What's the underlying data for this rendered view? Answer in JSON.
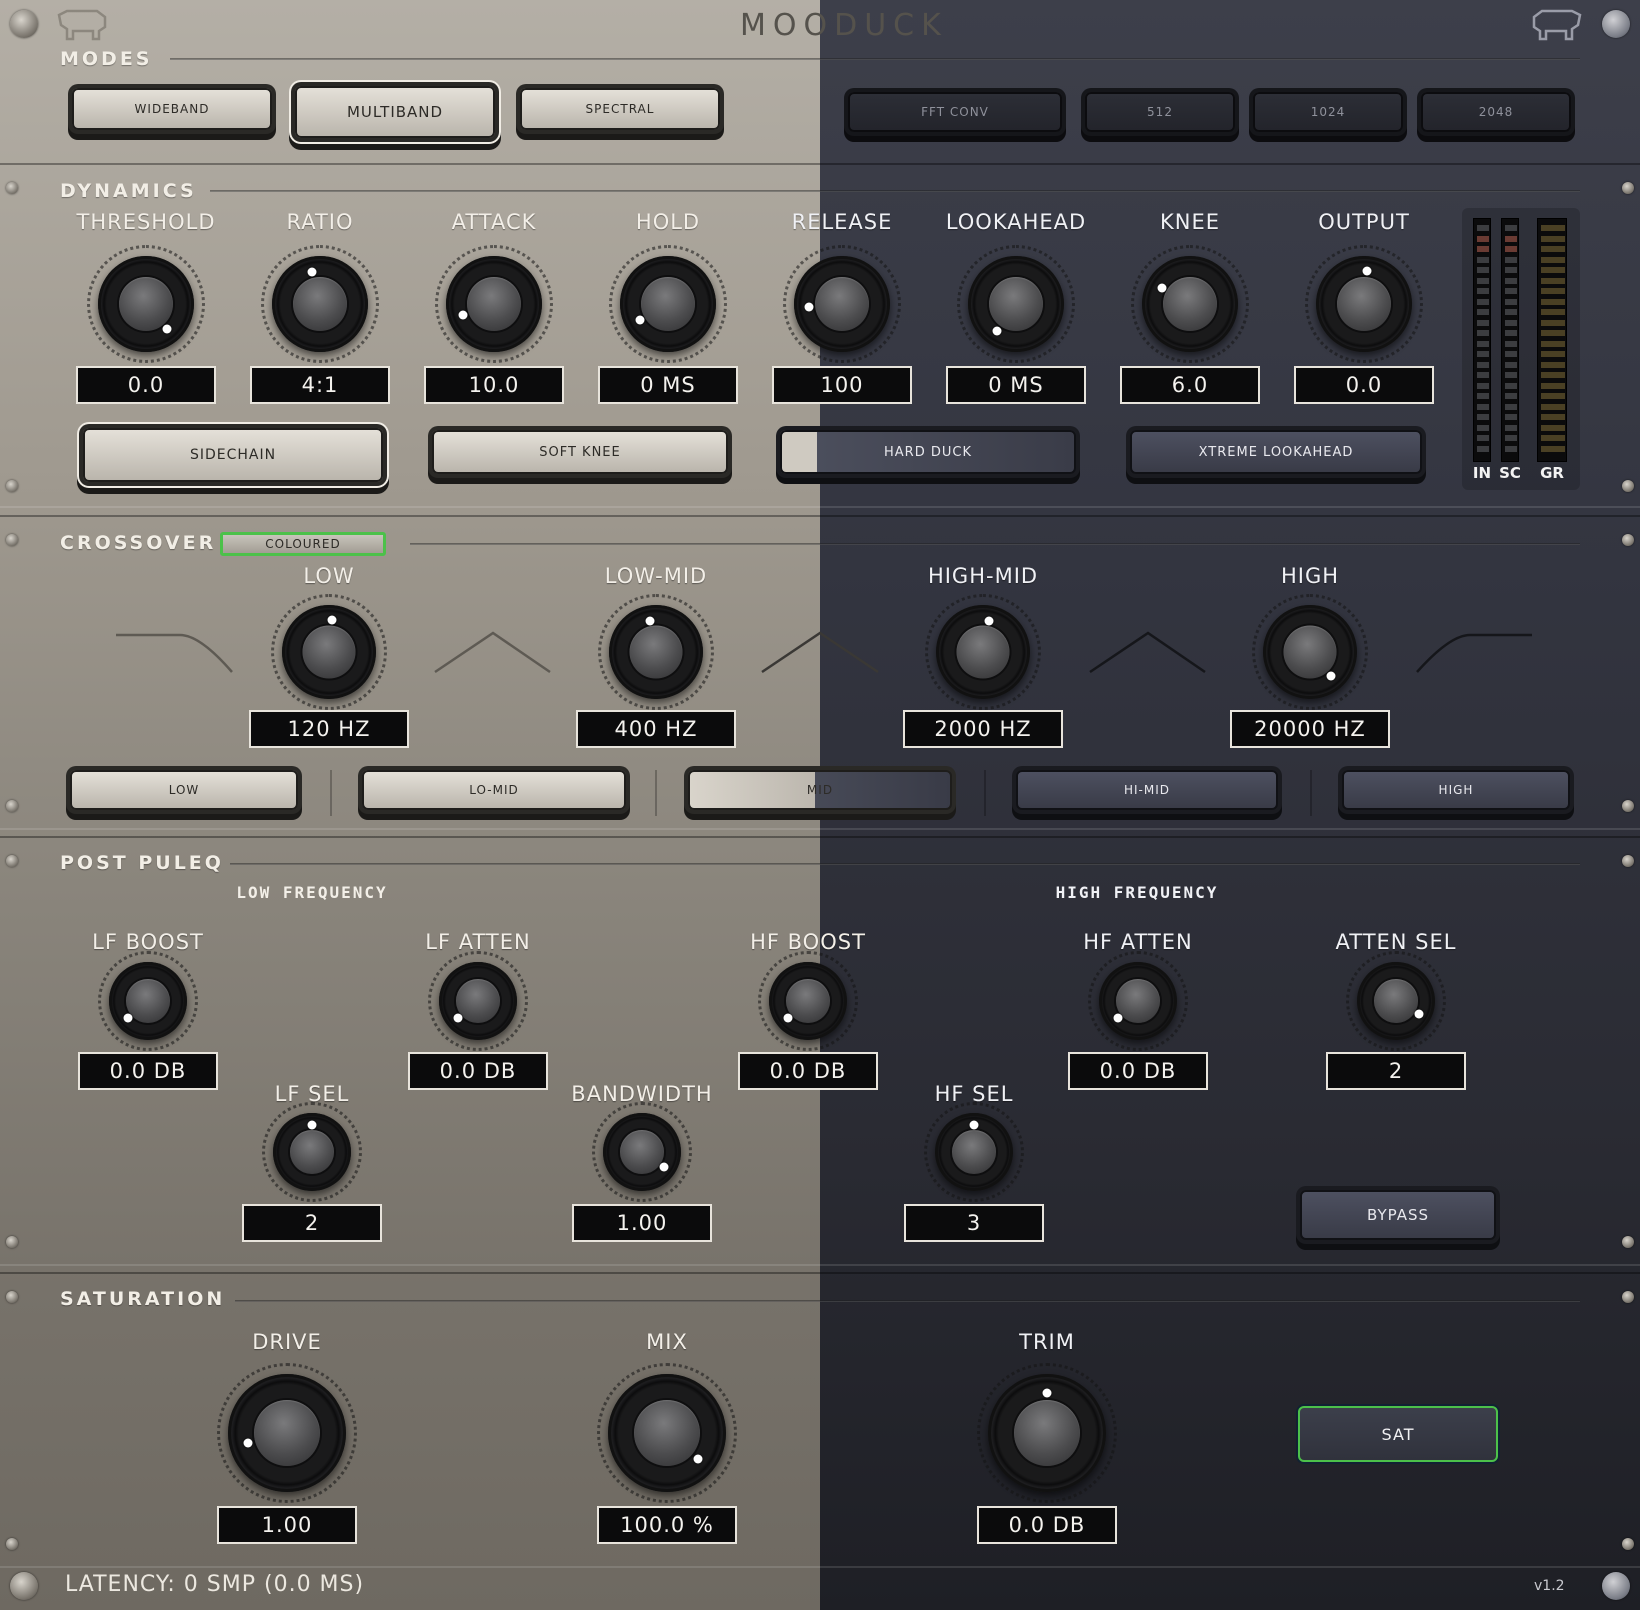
{
  "header": {
    "title": "MOODUCK",
    "version": "v1.2"
  },
  "modes": {
    "title": "MODES",
    "buttons": [
      "WIDEBAND",
      "MULTIBAND",
      "SPECTRAL"
    ],
    "selected": "MULTIBAND",
    "fft_buttons": [
      "FFT CONV",
      "512",
      "1024",
      "2048"
    ]
  },
  "dynamics": {
    "title": "DYNAMICS",
    "knobs": [
      {
        "label": "THRESHOLD",
        "value": "0.0"
      },
      {
        "label": "RATIO",
        "value": "4:1"
      },
      {
        "label": "ATTACK",
        "value": "10.0"
      },
      {
        "label": "HOLD",
        "value": "0 MS"
      },
      {
        "label": "RELEASE",
        "value": "100"
      },
      {
        "label": "LOOKAHEAD",
        "value": "0 MS"
      },
      {
        "label": "KNEE",
        "value": "6.0"
      },
      {
        "label": "OUTPUT",
        "value": "0.0"
      }
    ],
    "toggles": [
      "SIDECHAIN",
      "SOFT KNEE",
      "HARD DUCK",
      "XTREME LOOKAHEAD"
    ],
    "meters": {
      "in": "IN",
      "sc": "SC",
      "gr": "GR"
    }
  },
  "crossover": {
    "title": "CROSSOVER",
    "coloured_label": "COLOURED",
    "knobs": [
      {
        "label": "LOW",
        "value": "120 HZ"
      },
      {
        "label": "LOW-MID",
        "value": "400 HZ"
      },
      {
        "label": "HIGH-MID",
        "value": "2000 HZ"
      },
      {
        "label": "HIGH",
        "value": "20000 HZ"
      }
    ],
    "band_buttons": [
      "LOW",
      "LO-MID",
      "MID",
      "HI-MID",
      "HIGH"
    ]
  },
  "puleq": {
    "title": "POST PULEQ",
    "low_frequency": "LOW FREQUENCY",
    "high_frequency": "HIGH FREQUENCY",
    "lf_boost": {
      "label": "LF BOOST",
      "value": "0.0 DB"
    },
    "lf_atten": {
      "label": "LF ATTEN",
      "value": "0.0 DB"
    },
    "hf_boost": {
      "label": "HF BOOST",
      "value": "0.0 DB"
    },
    "hf_atten": {
      "label": "HF ATTEN",
      "value": "0.0 DB"
    },
    "atten_sel": {
      "label": "ATTEN SEL",
      "value": "2"
    },
    "lf_sel": {
      "label": "LF SEL",
      "value": "2"
    },
    "bandwidth": {
      "label": "BANDWIDTH",
      "value": "1.00"
    },
    "hf_sel": {
      "label": "HF SEL",
      "value": "3"
    },
    "bypass": "BYPASS"
  },
  "saturation": {
    "title": "SATURATION",
    "drive": {
      "label": "DRIVE",
      "value": "1.00"
    },
    "mix": {
      "label": "MIX",
      "value": "100.0 %"
    },
    "trim": {
      "label": "TRIM",
      "value": "0.0 DB"
    },
    "sat_button": "SAT"
  },
  "footer": {
    "latency": "LATENCY: 0 SMP (0.0 MS)"
  },
  "colors": {
    "accent_green": "#4cc14a",
    "light_theme": "#b4afa6",
    "dark_theme": "#333540"
  }
}
